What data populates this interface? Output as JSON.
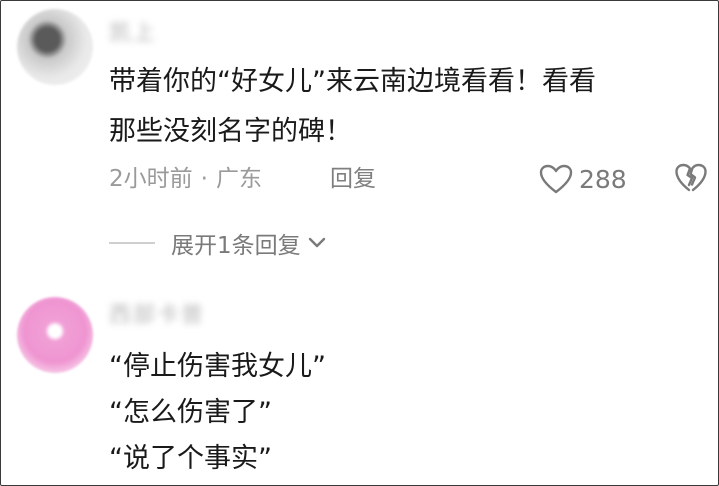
{
  "comments": [
    {
      "username": "凯上",
      "text_lines": [
        "带着你的“好女儿”来云南边境看看！看看",
        "那些没刻名字的碑！"
      ],
      "time": "2小时前",
      "separator": "·",
      "location": "广东",
      "reply_label": "回复",
      "likes": "288",
      "expand_label": "展开1条回复"
    },
    {
      "username": "西部卡普",
      "text_lines": [
        "“停止伤害我女儿”",
        "“怎么伤害了”",
        "“说了个事实”"
      ]
    }
  ],
  "icons": {
    "like": "heart-outline-icon",
    "dislike": "broken-heart-icon",
    "expand": "chevron-down-icon"
  },
  "colors": {
    "text": "#1a1a1a",
    "meta": "#9a9a9a",
    "icon": "#7a7a7a"
  }
}
